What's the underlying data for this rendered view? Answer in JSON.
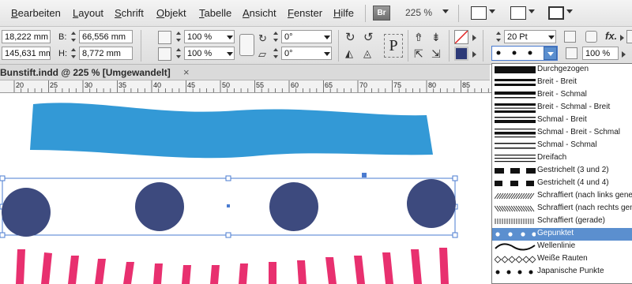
{
  "menu": {
    "items": [
      "Bearbeiten",
      "Layout",
      "Schrift",
      "Objekt",
      "Tabelle",
      "Ansicht",
      "Fenster",
      "Hilfe"
    ],
    "bridge_badge": "Br",
    "zoom": "225 %"
  },
  "control": {
    "x_value": "18,222 mm",
    "y_value": "145,631 mm",
    "width_label": "B:",
    "width_value": "66,556 mm",
    "height_label": "H:",
    "height_value": "8,772 mm",
    "scale_x": "100 %",
    "scale_y": "100 %",
    "rotation": "0°",
    "shear": "0°",
    "text_frame_glyph": "P",
    "stroke_weight": "20 Pt",
    "opacity": "100 %",
    "fx_label": "fx."
  },
  "document": {
    "tab_title": "Bunstift.indd @ 225 % [Umgewandelt]",
    "close_glyph": "×",
    "ruler_labels": [
      "20",
      "25",
      "30",
      "35",
      "40",
      "45",
      "50",
      "55",
      "60",
      "65",
      "70",
      "75",
      "80",
      "85"
    ]
  },
  "colors": {
    "blue_stroke": "#3399d6",
    "dots": "#3d4a7e",
    "pink": "#e8306f",
    "selection": "#4a7bd0",
    "selected_row": "#5b8fcf"
  },
  "stroke_types": [
    {
      "label": "Durchgezogen",
      "icon": "solid-thick"
    },
    {
      "label": "Breit - Breit",
      "icon": "thick-thick"
    },
    {
      "label": "Breit - Schmal",
      "icon": "thick-thin"
    },
    {
      "label": "Breit - Schmal - Breit",
      "icon": "thick-thin-thick"
    },
    {
      "label": "Schmal - Breit",
      "icon": "thin-thick"
    },
    {
      "label": "Schmal - Breit - Schmal",
      "icon": "thin-thick-thin"
    },
    {
      "label": "Schmal - Schmal",
      "icon": "thin-thin"
    },
    {
      "label": "Dreifach",
      "icon": "triple"
    },
    {
      "label": "Gestrichelt (3 und 2)",
      "icon": "dashed-3-2"
    },
    {
      "label": "Gestrichelt (4 und 4)",
      "icon": "dashed-4-4"
    },
    {
      "label": "Schraffiert (nach links geneigt)",
      "icon": "hatch-left"
    },
    {
      "label": "Schraffiert (nach rechts geneigt)",
      "icon": "hatch-right"
    },
    {
      "label": "Schraffiert (gerade)",
      "icon": "hatch-straight"
    },
    {
      "label": "Gepunktet",
      "icon": "dotted",
      "selected": true
    },
    {
      "label": "Wellenlinie",
      "icon": "wavy"
    },
    {
      "label": "Weiße Rauten",
      "icon": "white-diamonds"
    },
    {
      "label": "Japanische Punkte",
      "icon": "japanese-dots"
    }
  ]
}
